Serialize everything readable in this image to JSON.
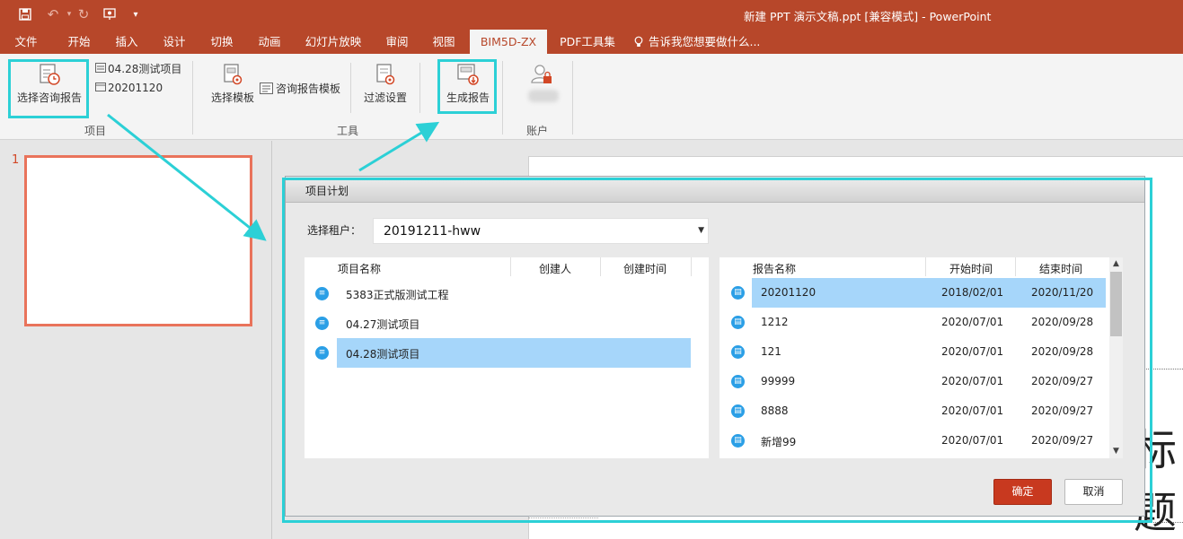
{
  "titlebar": {
    "title": "新建 PPT 演示文稿.ppt [兼容模式] - PowerPoint"
  },
  "tabs": [
    {
      "label": "文件"
    },
    {
      "label": "开始"
    },
    {
      "label": "插入"
    },
    {
      "label": "设计"
    },
    {
      "label": "切换"
    },
    {
      "label": "动画"
    },
    {
      "label": "幻灯片放映"
    },
    {
      "label": "审阅"
    },
    {
      "label": "视图"
    },
    {
      "label": "BIM5D-ZX"
    },
    {
      "label": "PDF工具集"
    },
    {
      "label": "告诉我您想要做什么..."
    }
  ],
  "ribbon": {
    "project": {
      "select_report": "选择咨询报告",
      "current_project": "04.28测试项目",
      "current_report": "20201120",
      "group_label": "项目"
    },
    "tools": {
      "select_template": "选择模板",
      "report_template": "咨询报告模板",
      "filter_settings": "过滤设置",
      "generate_report": "生成报告",
      "group_label": "工具"
    },
    "account": {
      "group_label": "账户"
    }
  },
  "slides": {
    "number": "1"
  },
  "canvas": {
    "partial_text": "标题"
  },
  "dialog": {
    "title": "项目计划",
    "tenant_label": "选择租户：",
    "tenant_value": "20191211-hww",
    "projects": {
      "headers": [
        "项目名称",
        "创建人",
        "创建时间"
      ],
      "rows": [
        {
          "name": "5383正式版测试工程"
        },
        {
          "name": "04.27测试项目"
        },
        {
          "name": "04.28测试项目"
        }
      ]
    },
    "reports": {
      "headers": [
        "报告名称",
        "开始时间",
        "结束时间"
      ],
      "rows": [
        {
          "name": "20201120",
          "start": "2018/02/01",
          "end": "2020/11/20"
        },
        {
          "name": "1212",
          "start": "2020/07/01",
          "end": "2020/09/28"
        },
        {
          "name": "121",
          "start": "2020/07/01",
          "end": "2020/09/28"
        },
        {
          "name": "99999",
          "start": "2020/07/01",
          "end": "2020/09/27"
        },
        {
          "name": "8888",
          "start": "2020/07/01",
          "end": "2020/09/27"
        },
        {
          "name": "新增99",
          "start": "2020/07/01",
          "end": "2020/09/27"
        }
      ]
    },
    "ok_label": "确定",
    "cancel_label": "取消"
  },
  "colors": {
    "accent": "#b7472a",
    "highlight": "#2cd0d6",
    "selection": "#a6d6fa",
    "ok_button": "#c8391f"
  }
}
